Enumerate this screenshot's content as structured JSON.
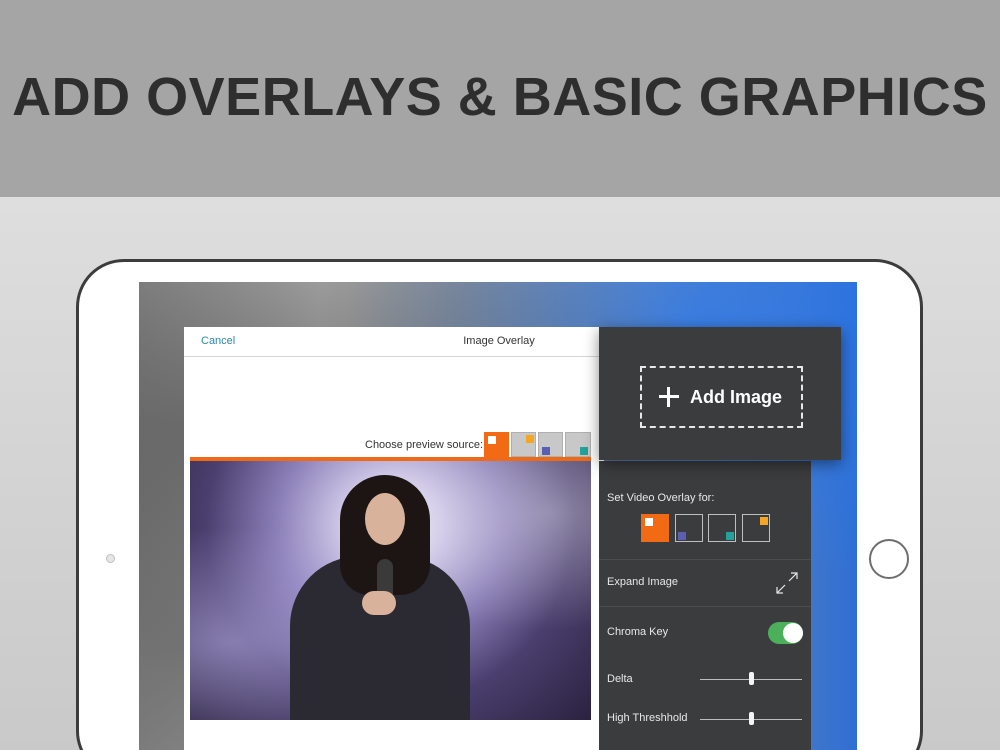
{
  "banner": {
    "title": "ADD OVERLAYS & BASIC GRAPHICS"
  },
  "modal": {
    "cancel_label": "Cancel",
    "title": "Image Overlay",
    "preview_label": "Choose preview source:",
    "preview_sources": [
      {
        "active": true,
        "marker_color": "#ffffff"
      },
      {
        "active": false,
        "marker_color": "#f5a623"
      },
      {
        "active": false,
        "marker_color": "#5a5fb0"
      },
      {
        "active": false,
        "marker_color": "#1fa39a"
      }
    ]
  },
  "popover": {
    "add_image_label": "Add Image",
    "icon": "plus-icon"
  },
  "panel": {
    "overlay_for_label": "Set Video Overlay for:",
    "overlay_sources": [
      {
        "active": true,
        "marker_color": "#ffffff"
      },
      {
        "active": false,
        "marker_color": "#5a5fb0"
      },
      {
        "active": false,
        "marker_color": "#1fa39a"
      },
      {
        "active": false,
        "marker_color": "#f5a623"
      }
    ],
    "expand_label": "Expand Image",
    "expand_icon": "expand-arrows-icon",
    "chroma_label": "Chroma Key",
    "chroma_enabled": true,
    "delta_label": "Delta",
    "delta_value": 0.5,
    "threshold_label": "High Threshhold",
    "threshold_value": 0.5
  },
  "colors": {
    "accent": "#ee6a17",
    "toggle_on": "#4cb05b",
    "panel_bg": "#3b3c3e",
    "link": "#2a8aa8"
  }
}
